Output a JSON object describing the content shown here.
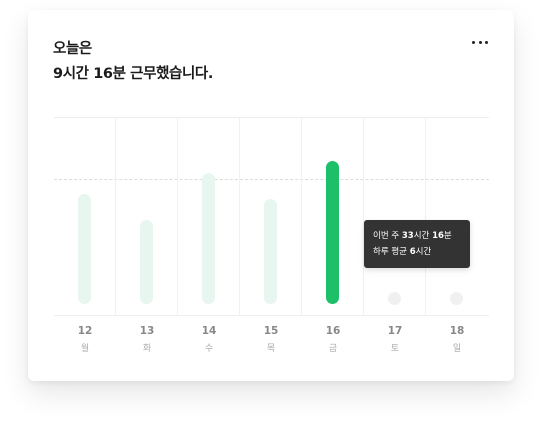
{
  "header": {
    "line1": "오늘은",
    "line2": "9시간 16분 근무했습니다.",
    "more_icon": "more-horizontal-icon"
  },
  "colors": {
    "accent": "#1dbf68",
    "bar_inactive": "#e7f6ef",
    "tooltip_bg": "#333333"
  },
  "chart_data": {
    "type": "bar",
    "categories": [
      "12",
      "13",
      "14",
      "15",
      "16",
      "17",
      "18"
    ],
    "weekdays": [
      "월",
      "화",
      "수",
      "목",
      "금",
      "토",
      "일"
    ],
    "values": [
      9.0,
      6.9,
      10.7,
      8.6,
      11.7,
      0,
      0
    ],
    "active_index": 4,
    "average": 6,
    "grid": true
  },
  "tooltip": {
    "week_prefix": "이번 주 ",
    "week_hours": "33",
    "week_hours_unit": "시간 ",
    "week_minutes": "16",
    "week_minutes_unit": "분",
    "avg_prefix": "하루 평균 ",
    "avg_hours": "6",
    "avg_hours_unit": "시간"
  }
}
